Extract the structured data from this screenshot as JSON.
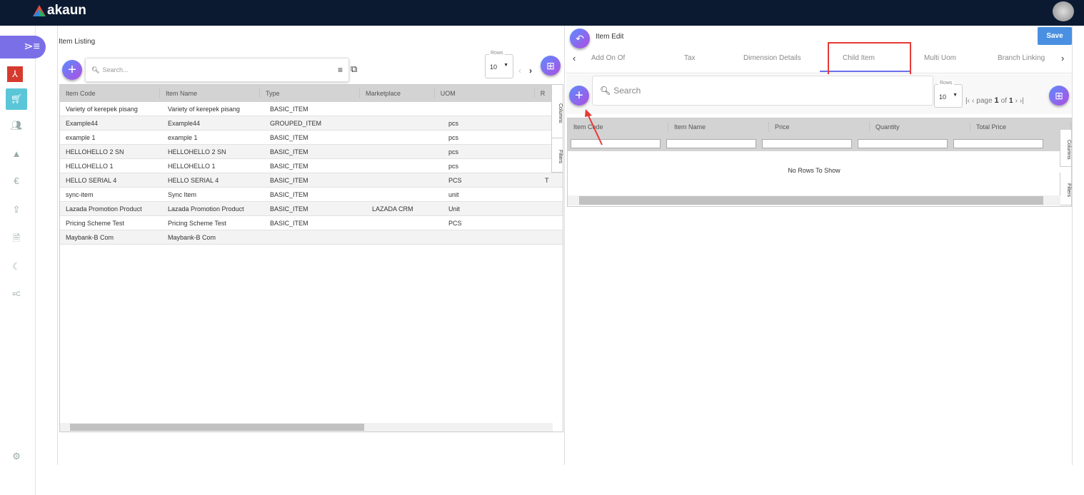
{
  "app": {
    "brand": "akaun"
  },
  "left": {
    "title": "Item Listing",
    "search_placeholder": "Search...",
    "rows_label": "Rows",
    "rows_value": "10",
    "columns": [
      "Item Code",
      "Item Name",
      "Type",
      "Marketplace",
      "UOM",
      "R"
    ],
    "rows": [
      [
        "Variety of kerepek pisang",
        "Variety of kerepek pisang",
        "BASIC_ITEM",
        "",
        ""
      ],
      [
        "Example44",
        "Example44",
        "GROUPED_ITEM",
        "",
        "pcs"
      ],
      [
        "example 1",
        "example 1",
        "BASIC_ITEM",
        "",
        "pcs"
      ],
      [
        "HELLOHELLO 2 SN",
        "HELLOHELLO 2 SN",
        "BASIC_ITEM",
        "",
        "pcs"
      ],
      [
        "HELLOHELLO 1",
        "HELLOHELLO 1",
        "BASIC_ITEM",
        "",
        "pcs"
      ],
      [
        "HELLO SERIAL 4",
        "HELLO SERIAL 4",
        "BASIC_ITEM",
        "",
        "PCS"
      ],
      [
        "sync-item",
        "Sync Item",
        "BASIC_ITEM",
        "",
        "unit"
      ],
      [
        "Lazada Promotion Product",
        "Lazada Promotion Product",
        "BASIC_ITEM",
        "LAZADA CRM",
        "Unit"
      ],
      [
        "Pricing Scheme Test",
        "Pricing Scheme Test",
        "BASIC_ITEM",
        "",
        "PCS"
      ],
      [
        "Maybank-B Com",
        "Maybank-B Com",
        "",
        "",
        ""
      ]
    ],
    "row6_extra": "T",
    "columns_tool": "Columns",
    "filters_tool": "Filters"
  },
  "right": {
    "title": "Item Edit",
    "save_label": "Save",
    "tabs": [
      "Add On Of",
      "Tax",
      "Dimension Details",
      "Child Item",
      "Multi Uom",
      "Branch Linking"
    ],
    "active_tab": "Child Item",
    "search_placeholder": "Search",
    "rows_label": "Rows",
    "rows_value": "10",
    "page_word": "page",
    "page": "1",
    "of_word": "of",
    "total_pages": "1",
    "columns": [
      "Item Code",
      "Item Name",
      "Price",
      "Quantity",
      "Total Price"
    ],
    "empty_text": "No Rows To Show",
    "columns_tool": "Columns",
    "filters_tool": "Filters"
  },
  "colors": {
    "topbar": "#0b1a31",
    "accent": "#4a90e2",
    "highlight": "#e53935"
  }
}
